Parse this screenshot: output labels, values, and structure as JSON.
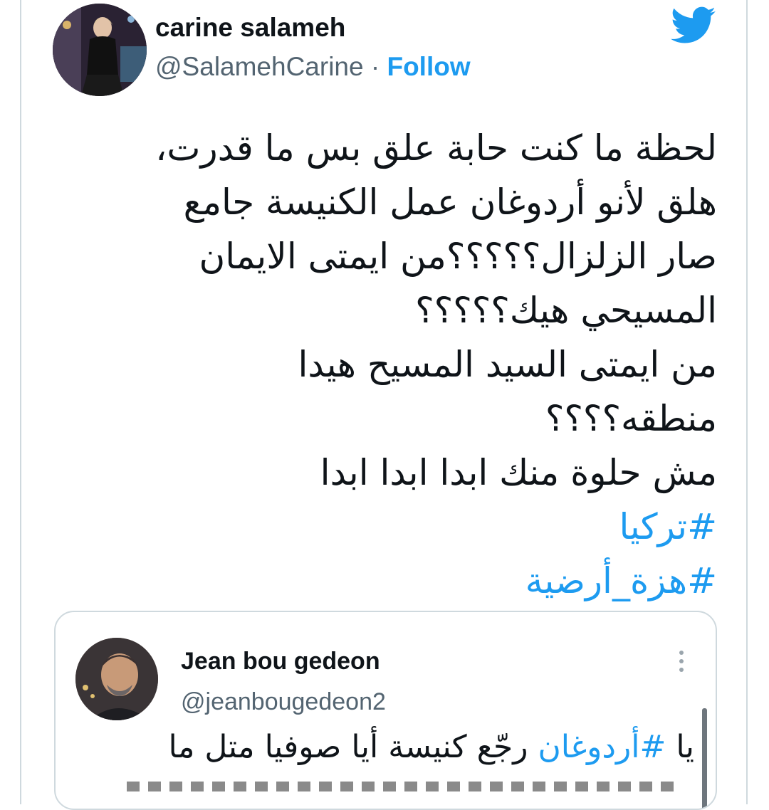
{
  "author": {
    "name": "carine salameh",
    "handle": "@SalamehCarine",
    "separator": "·",
    "follow_label": "Follow"
  },
  "tweet": {
    "lines": [
      "لحظة ما كنت حابة علق بس ما قدرت،",
      "هلق لأنو أردوغان عمل الكنيسة جامع",
      "صار الزلزال؟؟؟؟؟من ايمتى الايمان",
      "المسيحي هيك؟؟؟؟؟",
      "من ايمتى السيد المسيح هيدا",
      "منطقه؟؟؟؟",
      "مش حلوة منك ابدا ابدا ابدا"
    ],
    "hashtags": [
      "#تركيا",
      "#هزة_أرضية"
    ]
  },
  "quoted_tweet": {
    "name": "Jean bou gedeon",
    "handle": "@jeanbougedeon2",
    "text_prefix": "يا ",
    "hashtag": "#أردوغان",
    "text_suffix": " رجّع كنيسة أيا صوفيا متل ما"
  },
  "icons": {
    "brand": "twitter-bird-icon",
    "more": "more-vertical-icon"
  },
  "colors": {
    "accent": "#1d9bf0",
    "text": "#0f1419",
    "secondary": "#536471",
    "border": "#cfd9de"
  }
}
